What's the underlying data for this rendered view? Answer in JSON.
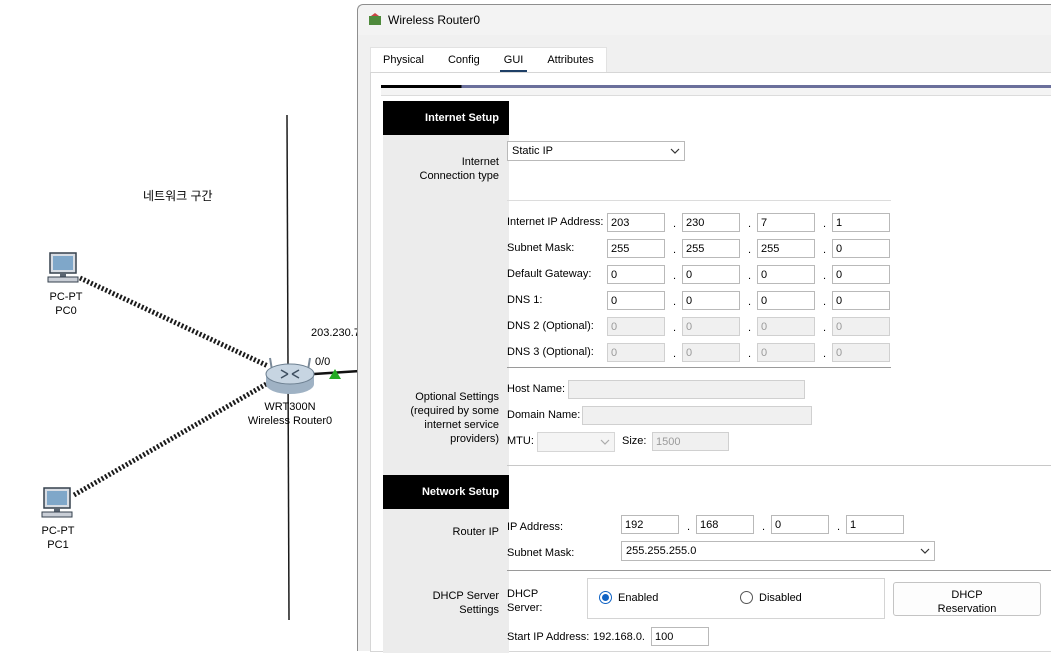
{
  "workspace": {
    "zone_label": "네트워크 구간",
    "pc0": {
      "type": "PC-PT",
      "name": "PC0"
    },
    "pc1": {
      "type": "PC-PT",
      "name": "PC1"
    },
    "router": {
      "model": "WRT300N",
      "name": "Wireless Router0"
    },
    "link_ip": "203.230.7",
    "port_label": "0/0",
    "link_color": "#22aa22"
  },
  "window": {
    "title": "Wireless Router0",
    "tabs": [
      {
        "label": "Physical",
        "active": false
      },
      {
        "label": "Config",
        "active": false
      },
      {
        "label": "GUI",
        "active": true
      },
      {
        "label": "Attributes",
        "active": false
      }
    ]
  },
  "internet_setup": {
    "section_title": "Internet Setup",
    "connection_type_label": "Internet\nConnection type",
    "connection_type": "Static IP",
    "internet_ip_label": "Internet IP Address:",
    "internet_ip": [
      "203",
      "230",
      "7",
      "1"
    ],
    "subnet_mask_label": "Subnet Mask:",
    "subnet_mask": [
      "255",
      "255",
      "255",
      "0"
    ],
    "default_gateway_label": "Default Gateway:",
    "default_gateway": [
      "0",
      "0",
      "0",
      "0"
    ],
    "dns1_label": "DNS 1:",
    "dns1": [
      "0",
      "0",
      "0",
      "0"
    ],
    "dns2_label": "DNS 2 (Optional):",
    "dns2": [
      "0",
      "0",
      "0",
      "0"
    ],
    "dns3_label": "DNS 3 (Optional):",
    "dns3": [
      "0",
      "0",
      "0",
      "0"
    ],
    "optional_settings_label": "Optional Settings\n(required by some\ninternet service\nproviders)",
    "host_name_label": "Host Name:",
    "host_name": "",
    "domain_name_label": "Domain Name:",
    "domain_name": "",
    "mtu_label": "MTU:",
    "mtu": "",
    "size_label": "Size:",
    "size": "1500"
  },
  "network_setup": {
    "section_title": "Network Setup",
    "router_ip_label": "Router IP",
    "ip_address_label": "IP Address:",
    "ip_address": [
      "192",
      "168",
      "0",
      "1"
    ],
    "subnet_mask_label": "Subnet Mask:",
    "subnet_mask": "255.255.255.0",
    "dhcp_settings_label": "DHCP Server\nSettings",
    "dhcp_server_label": "DHCP\nServer:",
    "enabled_label": "Enabled",
    "disabled_label": "Disabled",
    "dhcp_selected": "Enabled",
    "dhcp_reservation_label": "DHCP\nReservation",
    "start_ip_label": "Start IP Address:",
    "start_ip_prefix": "192.168.0.",
    "start_ip": "100"
  }
}
